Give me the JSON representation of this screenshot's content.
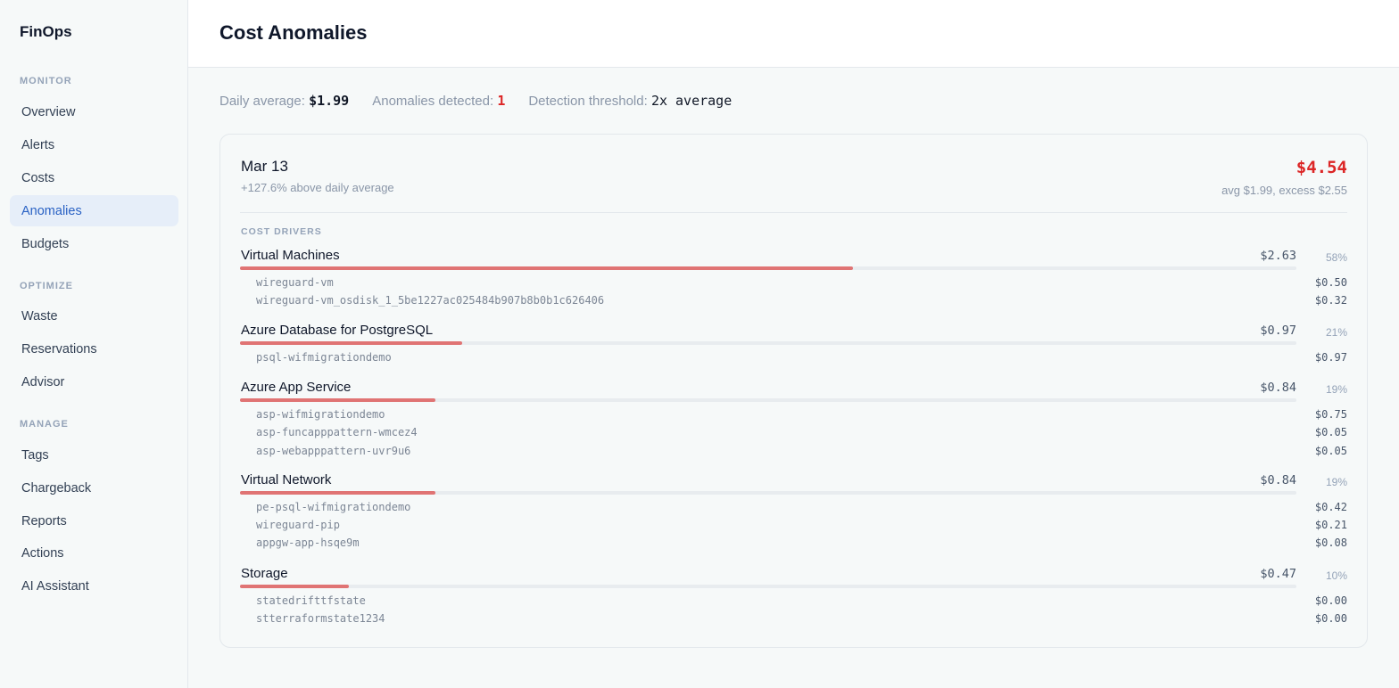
{
  "app": {
    "brand": "FinOps"
  },
  "sidebar": {
    "sections": [
      {
        "title": "MONITOR",
        "items": [
          "Overview",
          "Alerts",
          "Costs",
          "Anomalies",
          "Budgets"
        ]
      },
      {
        "title": "OPTIMIZE",
        "items": [
          "Waste",
          "Reservations",
          "Advisor"
        ]
      },
      {
        "title": "MANAGE",
        "items": [
          "Tags",
          "Chargeback",
          "Reports",
          "Actions",
          "AI Assistant"
        ]
      }
    ],
    "active_item": "Anomalies"
  },
  "header": {
    "title": "Cost Anomalies"
  },
  "stats": {
    "daily_average_label": "Daily average:",
    "daily_average_value": "$1.99",
    "anomalies_label": "Anomalies detected:",
    "anomalies_value": "1",
    "threshold_label": "Detection threshold:",
    "threshold_value": "2x average"
  },
  "anomaly": {
    "date": "Mar 13",
    "subtitle": "+127.6% above daily average",
    "total": "$4.54",
    "note": "avg $1.99, excess $2.55",
    "drivers_label": "COST DRIVERS",
    "groups": [
      {
        "name": "Virtual Machines",
        "amount": "$2.63",
        "pct_label": "58%",
        "pct": 58,
        "resources": [
          {
            "name": "wireguard-vm",
            "amount": "$0.50"
          },
          {
            "name": "wireguard-vm_osdisk_1_5be1227ac025484b907b8b0b1c626406",
            "amount": "$0.32"
          }
        ]
      },
      {
        "name": "Azure Database for PostgreSQL",
        "amount": "$0.97",
        "pct_label": "21%",
        "pct": 21,
        "resources": [
          {
            "name": "psql-wifmigrationdemo",
            "amount": "$0.97"
          }
        ]
      },
      {
        "name": "Azure App Service",
        "amount": "$0.84",
        "pct_label": "19%",
        "pct": 18.5,
        "resources": [
          {
            "name": "asp-wifmigrationdemo",
            "amount": "$0.75"
          },
          {
            "name": "asp-funcapppattern-wmcez4",
            "amount": "$0.05"
          },
          {
            "name": "asp-webapppattern-uvr9u6",
            "amount": "$0.05"
          }
        ]
      },
      {
        "name": "Virtual Network",
        "amount": "$0.84",
        "pct_label": "19%",
        "pct": 18.5,
        "resources": [
          {
            "name": "pe-psql-wifmigrationdemo",
            "amount": "$0.42"
          },
          {
            "name": "wireguard-pip",
            "amount": "$0.21"
          },
          {
            "name": "appgw-app-hsqe9m",
            "amount": "$0.08"
          }
        ]
      },
      {
        "name": "Storage",
        "amount": "$0.47",
        "pct_label": "10%",
        "pct": 10.3,
        "resources": [
          {
            "name": "statedrifttfstate",
            "amount": "$0.00"
          },
          {
            "name": "stterraformstate1234",
            "amount": "$0.00"
          }
        ]
      }
    ]
  },
  "colors": {
    "accent": "#2a62c4",
    "anomaly": "#dc2626",
    "bar": "#e07474"
  }
}
